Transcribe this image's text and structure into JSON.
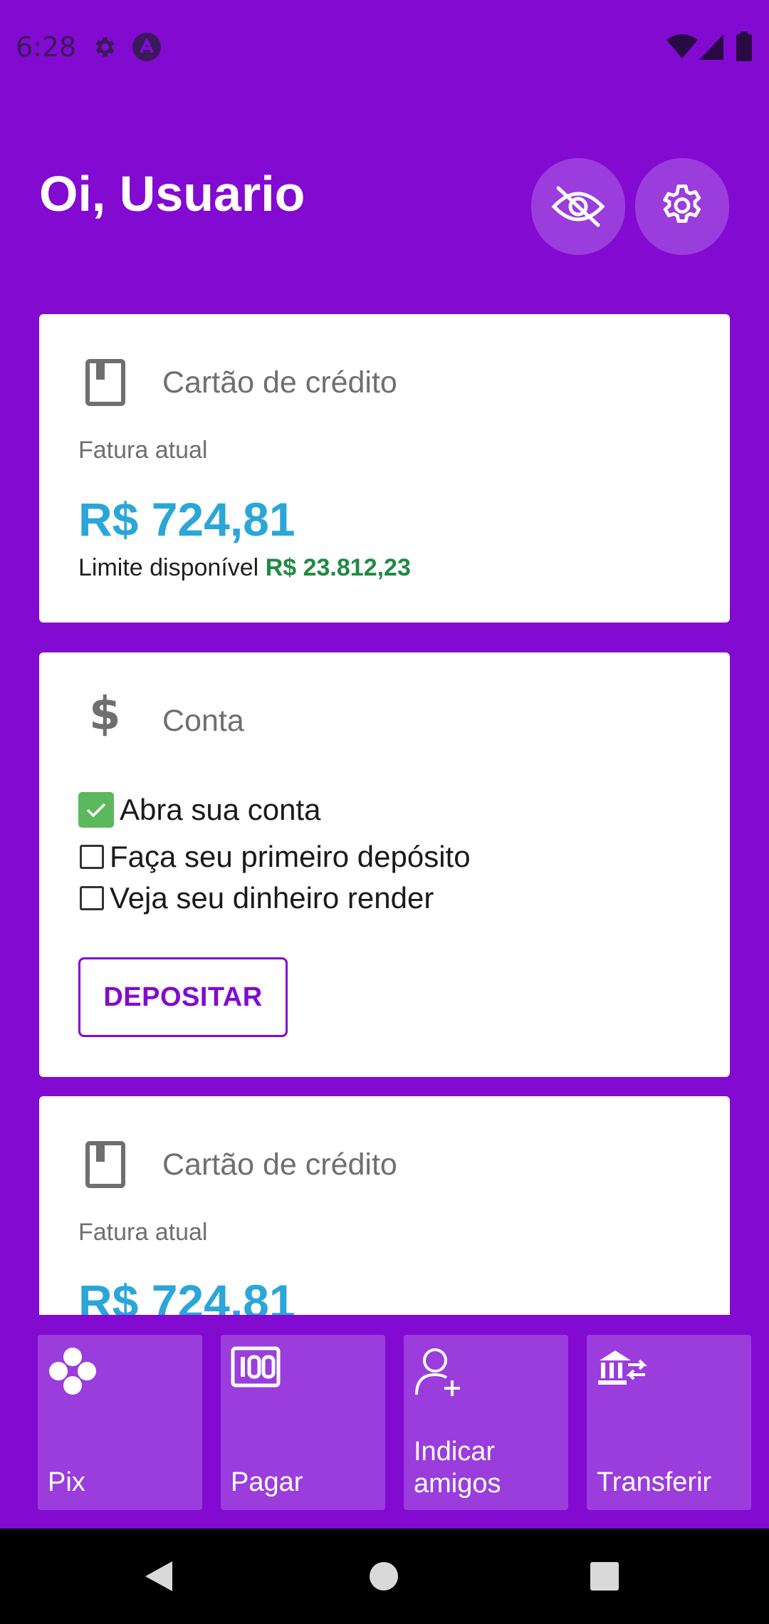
{
  "status_bar": {
    "time": "6:28",
    "icons": [
      "gear-icon",
      "app-a-icon",
      "wifi-icon",
      "signal-icon",
      "battery-icon"
    ]
  },
  "header": {
    "greeting": "Oi, Usuario",
    "buttons": [
      "eye-off-icon",
      "settings-icon"
    ]
  },
  "cards": {
    "credit1": {
      "title": "Cartão de crédito",
      "sub": "Fatura atual",
      "amount": "R$ 724,81",
      "limit_label": "Limite disponível",
      "limit_value": "R$ 23.812,23"
    },
    "account": {
      "title": "Conta",
      "checklist": [
        {
          "label": "Abra sua conta",
          "checked": true
        },
        {
          "label": "Faça seu primeiro depósito",
          "checked": false
        },
        {
          "label": "Veja seu dinheiro render",
          "checked": false
        }
      ],
      "deposit_button": "DEPOSITAR"
    },
    "credit2": {
      "title": "Cartão de crédito",
      "sub": "Fatura atual",
      "amount": "R$ 724,81"
    }
  },
  "actions": [
    {
      "label": "Pix",
      "icon": "pix-icon"
    },
    {
      "label": "Pagar",
      "icon": "barcode-icon"
    },
    {
      "label": "Indicar amigos",
      "icon": "add-person-icon"
    },
    {
      "label": "Transferir",
      "icon": "bank-transfer-icon"
    }
  ],
  "colors": {
    "brand": "#820ad1",
    "amount": "#2aa6d9",
    "limit": "#1f8a43",
    "check": "#5cb85c"
  }
}
